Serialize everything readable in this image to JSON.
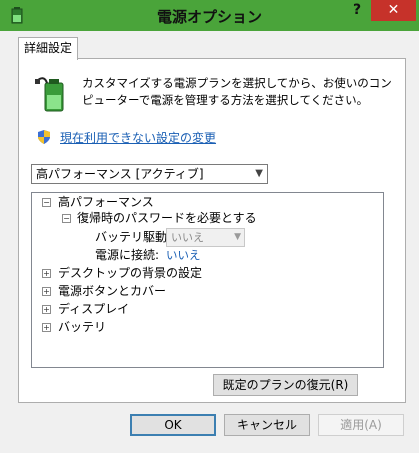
{
  "window": {
    "title": "電源オプション",
    "help": "?",
    "close": "✕"
  },
  "tab": {
    "label": "詳細設定"
  },
  "description": "カスタマイズする電源プランを選択してから、お使いのコンピューターで電源を管理する方法を選択してください。",
  "link_unavailable": "現在利用できない設定の変更",
  "plan_select": {
    "value": "高パフォーマンス [アクティブ]"
  },
  "tree": {
    "root": {
      "expander": "−",
      "label": "高パフォーマンス"
    },
    "child": {
      "expander": "−",
      "label": "復帰時のパスワードを必要とする"
    },
    "battery": {
      "label": "バッテリ駆動:",
      "value": "いいえ"
    },
    "ac": {
      "label": "電源に接続:",
      "value": "いいえ"
    },
    "items": [
      {
        "expander": "+",
        "label": "デスクトップの背景の設定"
      },
      {
        "expander": "+",
        "label": "電源ボタンとカバー"
      },
      {
        "expander": "+",
        "label": "ディスプレイ"
      },
      {
        "expander": "+",
        "label": "バッテリ"
      }
    ]
  },
  "buttons": {
    "restore": "既定のプランの復元(R)",
    "ok": "OK",
    "cancel": "キャンセル",
    "apply": "適用(A)"
  },
  "colors": {
    "titlebar": "#4aa43a",
    "close": "#c6322a",
    "link": "#1a5fb4"
  },
  "icons": [
    "app-battery-icon",
    "battery-plug-icon",
    "uac-shield-icon",
    "dropdown-arrow-icon"
  ]
}
